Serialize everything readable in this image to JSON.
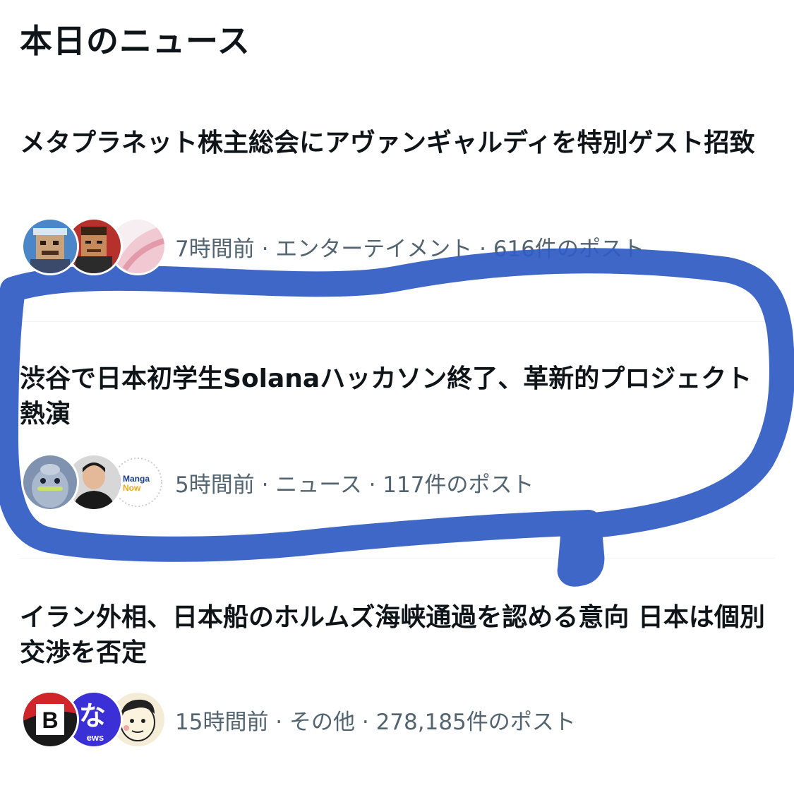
{
  "section": {
    "title": "本日のニュース"
  },
  "items": [
    {
      "headline": "メタプラネット株主総会にアヴァンギャルディを特別ゲスト招致",
      "meta": "7時間前 · エンターテイメント · 616件のポスト"
    },
    {
      "headline": "渋谷で日本初学生Solanaハッカソン終了、革新的プロジェクト熱演",
      "meta": "5時間前 · ニュース · 117件のポスト",
      "avatar_text": {
        "manga": "Manga",
        "now": "Now"
      }
    },
    {
      "headline": "イラン外相、日本船のホルムズ海峡通過を認める意向 日本は個別交渉を否定",
      "meta": "15時間前 · その他 · 278,185件のポスト",
      "avatar_text": {
        "b": "B",
        "na": "な",
        "ews": "ews"
      }
    }
  ],
  "colors": {
    "annotation_stroke": "#2f5bc4",
    "meta_text": "#536471",
    "divider": "#eff3f4"
  }
}
